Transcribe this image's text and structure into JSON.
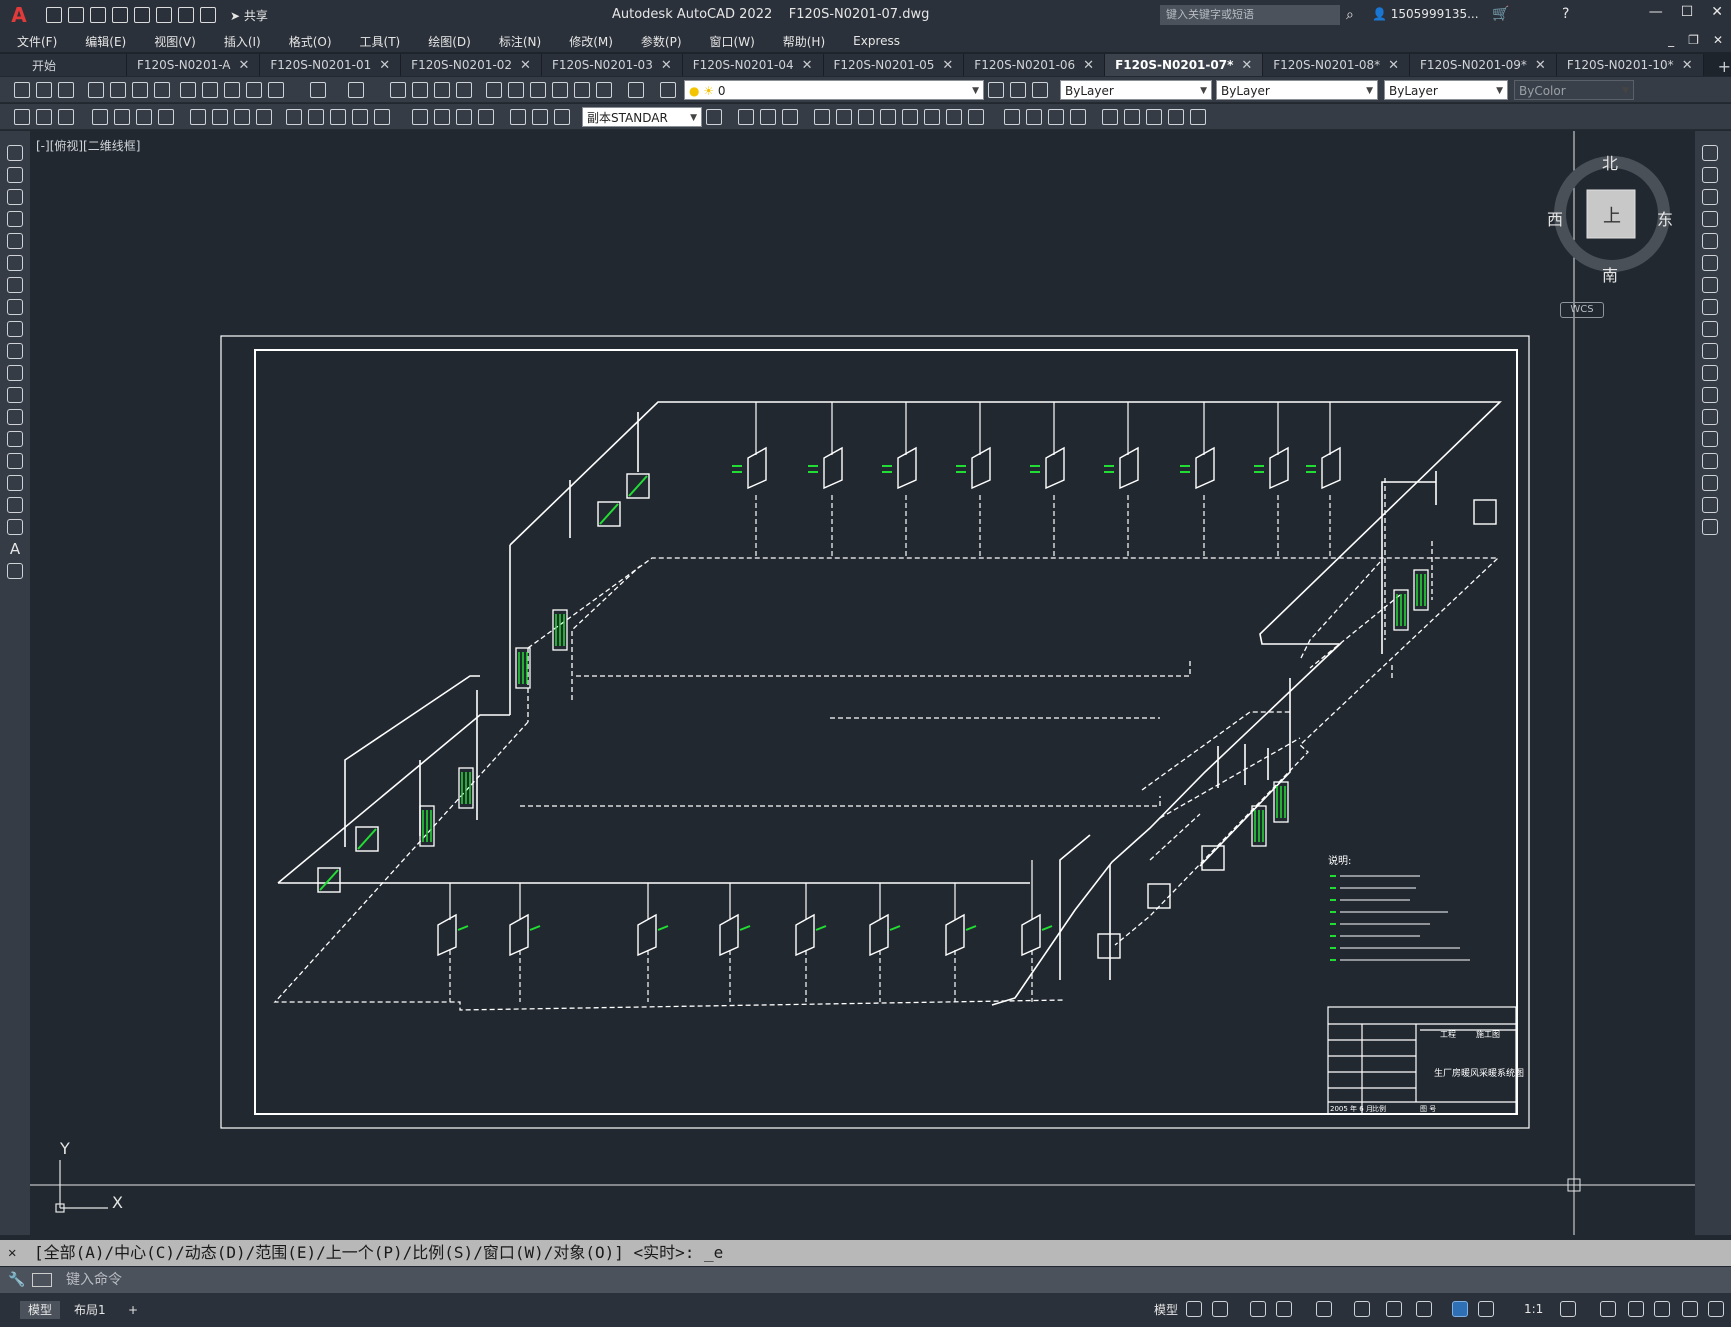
{
  "app": {
    "title": "Autodesk AutoCAD 2022",
    "filename": "F120S-N0201-07.dwg",
    "share_label": "共享",
    "search_placeholder": "键入关键字或短语",
    "user": "1505999135...",
    "logo": "A"
  },
  "menu": [
    "文件(F)",
    "编辑(E)",
    "视图(V)",
    "插入(I)",
    "格式(O)",
    "工具(T)",
    "绘图(D)",
    "标注(N)",
    "修改(M)",
    "参数(P)",
    "窗口(W)",
    "帮助(H)",
    "Express"
  ],
  "tabs": [
    {
      "label": "开始",
      "active": false,
      "close": false
    },
    {
      "label": "F120S-N0201-A",
      "active": false,
      "close": true
    },
    {
      "label": "F120S-N0201-01",
      "active": false,
      "close": true
    },
    {
      "label": "F120S-N0201-02",
      "active": false,
      "close": true
    },
    {
      "label": "F120S-N0201-03",
      "active": false,
      "close": true
    },
    {
      "label": "F120S-N0201-04",
      "active": false,
      "close": true
    },
    {
      "label": "F120S-N0201-05",
      "active": false,
      "close": true
    },
    {
      "label": "F120S-N0201-06",
      "active": false,
      "close": true
    },
    {
      "label": "F120S-N0201-07*",
      "active": true,
      "close": true
    },
    {
      "label": "F120S-N0201-08*",
      "active": false,
      "close": true
    },
    {
      "label": "F120S-N0201-09*",
      "active": false,
      "close": true
    },
    {
      "label": "F120S-N0201-10*",
      "active": false,
      "close": true
    }
  ],
  "toolbar": {
    "layer_value": "0",
    "color_value": "ByLayer",
    "linetype_value": "ByLayer",
    "lineweight_value": "ByLayer",
    "plotstyle_value": "ByColor",
    "textstyle_value": "副本STANDAR"
  },
  "viewport": {
    "label": "[-][俯视][二维线框]",
    "compass": {
      "north": "北",
      "south": "南",
      "east": "东",
      "west": "西",
      "center": "上"
    },
    "wcs": "WCS",
    "ucs_x": "X",
    "ucs_y": "Y"
  },
  "drawing": {
    "title_block_name": "生厂房暖风采暖系统图",
    "title_block_header": "工程",
    "title_block_stage": "施工图",
    "title_block_date": "2005 年 6 月",
    "title_block_scale": "比例",
    "title_block_drawing_no": "图 号",
    "notes_title": "说明:"
  },
  "command": {
    "prompt": "[全部(A)/中心(C)/动态(D)/范围(E)/上一个(P)/比例(S)/窗口(W)/对象(O)] <实时>: _e",
    "input_placeholder": "键入命令"
  },
  "status": {
    "model_tab": "模型",
    "layout_tab": "布局1",
    "model_label": "模型",
    "scale": "1:1"
  },
  "colors": {
    "canvas": "#212830",
    "accent_green": "#22dd33",
    "line": "#ffffff",
    "panel": "#353c45"
  }
}
